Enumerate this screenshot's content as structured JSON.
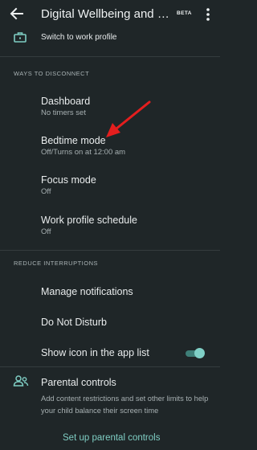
{
  "header": {
    "title": "Digital Wellbeing and parental controls",
    "badge": "BETA",
    "back_icon": "arrow-left-icon",
    "more_icon": "more-vert-icon"
  },
  "work_profile": {
    "label": "Switch to work profile",
    "icon": "briefcase-icon"
  },
  "ways_section": {
    "header": "WAYS TO DISCONNECT",
    "items": [
      {
        "title": "Dashboard",
        "subtitle": "No timers set"
      },
      {
        "title": "Bedtime mode",
        "subtitle": "Off/Turns on at 12:00 am"
      },
      {
        "title": "Focus mode",
        "subtitle": "Off"
      },
      {
        "title": "Work profile schedule",
        "subtitle": "Off"
      }
    ]
  },
  "reduce_section": {
    "header": "REDUCE INTERRUPTIONS",
    "items": [
      {
        "title": "Manage notifications"
      },
      {
        "title": "Do Not Disturb"
      },
      {
        "title": "Show icon in the app list",
        "toggle_on": true
      }
    ]
  },
  "parental": {
    "title": "Parental controls",
    "icon": "parental-controls-icon",
    "description": "Add content restrictions and set other limits to help your child balance their screen time",
    "action": "Set up parental controls"
  },
  "colors": {
    "background": "#1f2628",
    "accent": "#7fcdc3",
    "annotation_arrow": "#e41e1e"
  }
}
